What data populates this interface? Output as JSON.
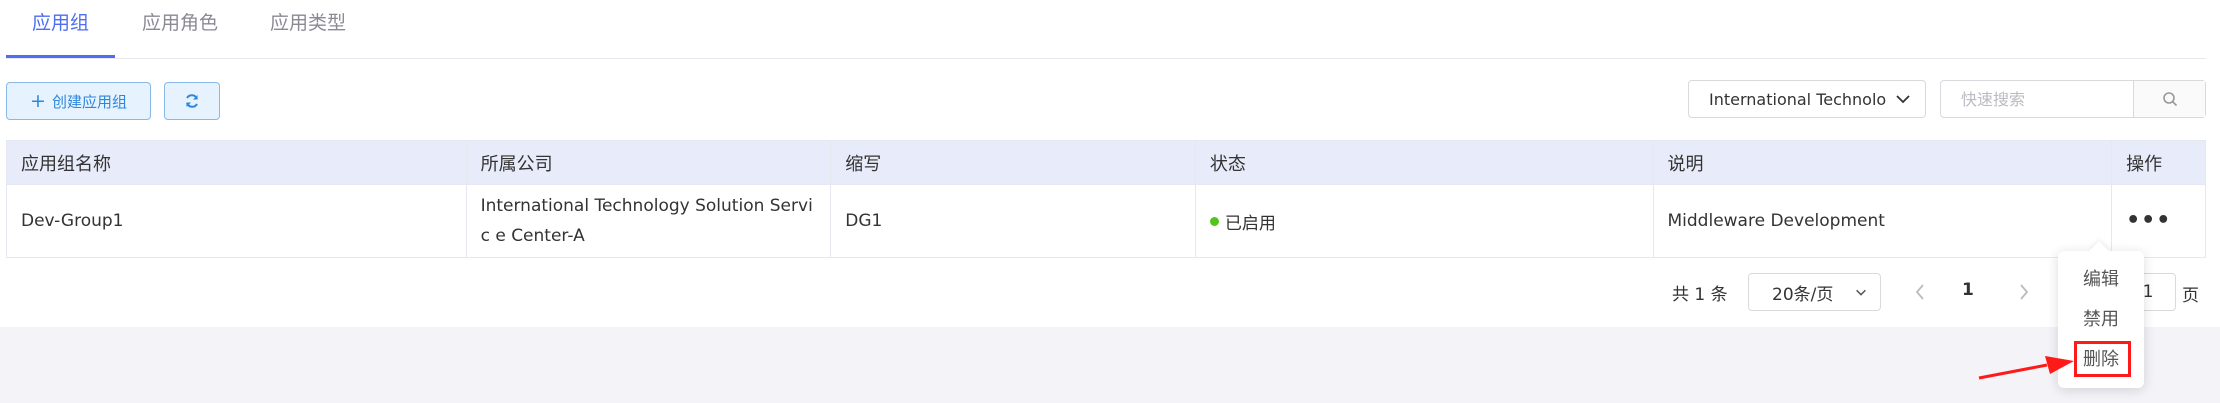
{
  "tabs": [
    {
      "label": "应用组",
      "active": true
    },
    {
      "label": "应用角色",
      "active": false
    },
    {
      "label": "应用类型",
      "active": false
    }
  ],
  "toolbar": {
    "create_label": "创建应用组",
    "company_select_value": "International Technolo",
    "search_placeholder": "快速搜索"
  },
  "table": {
    "headers": [
      "应用组名称",
      "所属公司",
      "缩写",
      "状态",
      "说明",
      "操作"
    ],
    "rows": [
      {
        "name": "Dev-Group1",
        "company": "International Technology Solution Servic e Center-A",
        "abbr": "DG1",
        "status": "已启用",
        "description": "Middleware Development",
        "action": "•••"
      }
    ]
  },
  "pagination": {
    "total": "共 1 条",
    "page_size": "20条/页",
    "current_page": "1",
    "jump_value": "1",
    "page_unit": "页"
  },
  "action_menu": {
    "items": [
      "编辑",
      "禁用",
      "删除"
    ],
    "highlighted": "删除"
  },
  "colors": {
    "accent": "#4e6ef2",
    "status_enabled": "#52c41a",
    "highlight": "#ff1a1a",
    "header_bg": "#e8ecfa"
  }
}
